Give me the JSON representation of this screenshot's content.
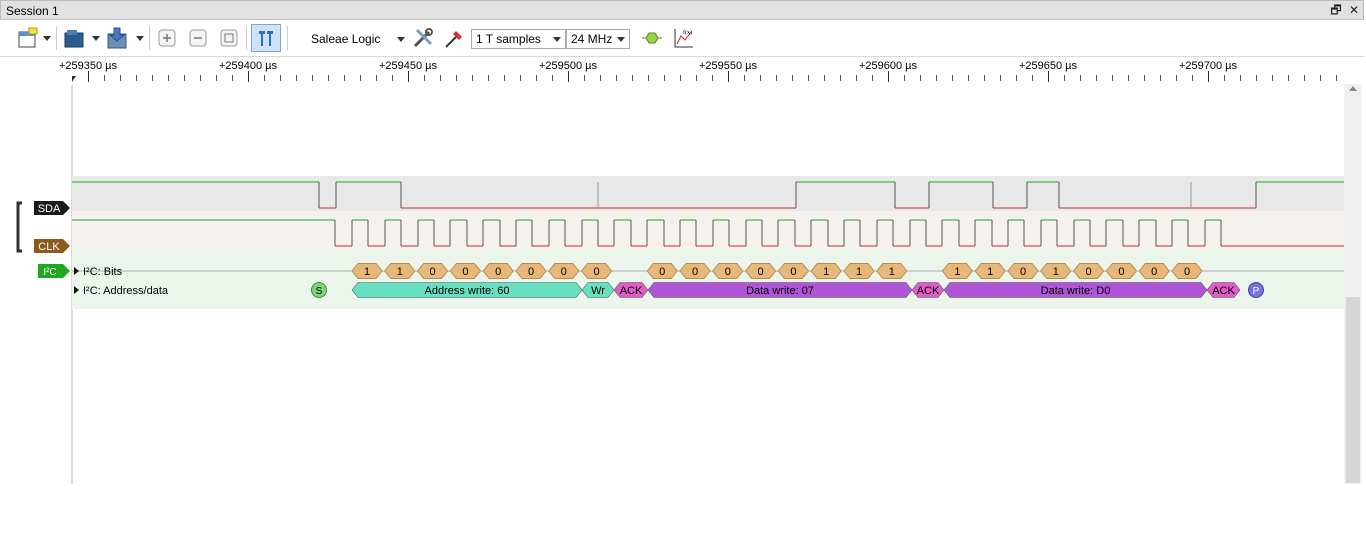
{
  "window": {
    "title": "Session 1",
    "restore_icon": "restore-icon",
    "close_icon": "close-icon"
  },
  "toolbar": {
    "device": "Saleae Logic",
    "samples": "1 T samples",
    "rate": "24 MHz",
    "icons": [
      "new-session-icon",
      "open-file-icon",
      "save-icon",
      "zoom-in-icon",
      "zoom-out-icon",
      "zoom-fit-icon",
      "snap-cursor-icon",
      "device-settings-icon",
      "probe-icon",
      "analyzer-icon",
      "function-icon"
    ]
  },
  "ruler": {
    "labels": [
      "+259350 µs",
      "+259400 µs",
      "+259450 µs",
      "+259500 µs",
      "+259550 µs",
      "+259600 µs",
      "+259650 µs",
      "+259700 µs"
    ]
  },
  "channels": [
    {
      "label": "SDA",
      "color": "#1a1a1a"
    },
    {
      "label": "CLK",
      "color": "#8b5a1e"
    }
  ],
  "analyzer": {
    "tag": "I²C",
    "bits_label": "I²C: Bits",
    "data_label": "I²C: Address/data",
    "bits": [
      "1",
      "1",
      "0",
      "0",
      "0",
      "0",
      "0",
      "0",
      "0",
      "0",
      "0",
      "0",
      "0",
      "1",
      "1",
      "1",
      "1",
      "1",
      "0",
      "1",
      "0",
      "0",
      "0",
      "0"
    ],
    "start": "S",
    "stop": "P",
    "frames": [
      {
        "text": "Address write: 60",
        "kind": "data"
      },
      {
        "text": "Wr",
        "kind": "data"
      },
      {
        "text": "ACK",
        "kind": "ack"
      },
      {
        "text": "Data write: 07",
        "kind": "write"
      },
      {
        "text": "ACK",
        "kind": "ack"
      },
      {
        "text": "Data write: D0",
        "kind": "write"
      },
      {
        "text": "ACK",
        "kind": "ack"
      }
    ]
  },
  "colors": {
    "high": "#2aa02a",
    "low": "#c03030",
    "bit_fill": "#e8b77a",
    "addr_fill": "#66e0c0",
    "ack_fill": "#e05cc8",
    "write_fill": "#b055d8",
    "start_fill": "#7fd27f",
    "stop_fill": "#7b6fe0"
  }
}
